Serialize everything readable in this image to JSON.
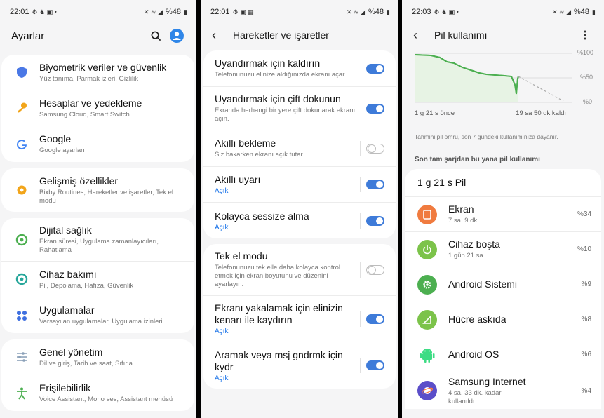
{
  "settings": {
    "status_time": "22:01",
    "status_battery": "%48",
    "title": "Ayarlar",
    "items": [
      {
        "title": "Biyometrik veriler ve güvenlik",
        "subtitle": "Yüz tanıma, Parmak izleri, Gizlilik"
      },
      {
        "title": "Hesaplar ve yedekleme",
        "subtitle": "Samsung Cloud, Smart Switch"
      },
      {
        "title": "Google",
        "subtitle": "Google ayarları"
      },
      {
        "title": "Gelişmiş özellikler",
        "subtitle": "Bixby Routines, Hareketler ve işaretler, Tek el modu"
      },
      {
        "title": "Dijital sağlık",
        "subtitle": "Ekran süresi, Uygulama zamanlayıcıları, Rahatlama"
      },
      {
        "title": "Cihaz bakımı",
        "subtitle": "Pil, Depolama, Hafıza, Güvenlik"
      },
      {
        "title": "Uygulamalar",
        "subtitle": "Varsayılan uygulamalar, Uygulama izinleri"
      },
      {
        "title": "Genel yönetim",
        "subtitle": "Dil ve giriş, Tarih ve saat, Sıfırla"
      },
      {
        "title": "Erişilebilirlik",
        "subtitle": "Voice Assistant, Mono ses, Assistant menüsü"
      }
    ],
    "colors": {
      "blue": "#3e6fe0",
      "orange": "#f2a51a",
      "teal": "#26a69a",
      "green": "#4caf50"
    }
  },
  "motions": {
    "status_time": "22:01",
    "status_battery": "%48",
    "title": "Hareketler ve işaretler",
    "items": [
      {
        "title": "Uyandırmak için kaldırın",
        "subtitle": "Telefonunuzu elinize aldığınızda ekranı açar.",
        "on": true
      },
      {
        "title": "Uyandırmak için çift dokunun",
        "subtitle": "Ekranda herhangi bir yere çift dokunarak ekranı açın.",
        "on": true
      },
      {
        "title": "Akıllı bekleme",
        "subtitle": "Siz bakarken ekranı açık tutar.",
        "on": false
      },
      {
        "title": "Akıllı uyarı",
        "status": "Açık",
        "on": true
      },
      {
        "title": "Kolayca sessize alma",
        "status": "Açık",
        "on": true
      },
      {
        "title": "Tek el modu",
        "subtitle": "Telefonunuzu tek elle daha kolayca kontrol etmek için ekran boyutunu ve düzenini ayarlayın.",
        "on": false
      },
      {
        "title": "Ekranı yakalamak için elinizin kenarı ile kaydırın",
        "status": "Açık",
        "on": true
      },
      {
        "title": "Aramak veya msj gndrmk için kydr",
        "status": "Açık",
        "on": true
      }
    ]
  },
  "battery": {
    "status_time": "22:03",
    "status_battery": "%48",
    "title": "Pil kullanımı",
    "chart_axis": [
      "%100",
      "%50",
      "%0"
    ],
    "chart_start_label": "1 g 21 s önce",
    "chart_end_label": "19 sa 50 dk kaldı",
    "chart_note": "Tahmini pil ömrü, son 7 gündeki kullanımınıza dayanır.",
    "section_label": "Son tam şarjdan bu yana pil kullanımı",
    "total": "1 g 21 s Pil",
    "apps": [
      {
        "name": "Ekran",
        "detail": "7 sa. 9 dk.",
        "percent": "%34",
        "color": "#f07b3f"
      },
      {
        "name": "Cihaz boşta",
        "detail": "1 gün 21 sa.",
        "percent": "%10",
        "color": "#7cc34a"
      },
      {
        "name": "Android Sistemi",
        "detail": "",
        "percent": "%9",
        "color": "#4caf50"
      },
      {
        "name": "Hücre askıda",
        "detail": "",
        "percent": "%8",
        "color": "#7cc34a"
      },
      {
        "name": "Android OS",
        "detail": "",
        "percent": "%6",
        "color": "#3ddc84"
      },
      {
        "name": "Samsung Internet",
        "detail": "4 sa. 33 dk. kadar kullanıldı",
        "percent": "%4",
        "color": "#5b4ec9"
      }
    ]
  }
}
